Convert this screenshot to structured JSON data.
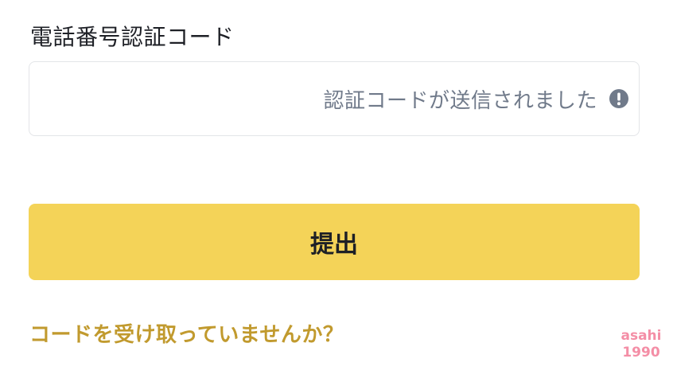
{
  "form": {
    "field_label": "電話番号認証コード",
    "input_value": "",
    "input_status": "認証コードが送信されました",
    "status_icon": "exclamation-circle-icon",
    "submit_label": "提出",
    "resend_link": "コードを受け取っていませんか？"
  },
  "watermark": {
    "line1": "asahi",
    "line2": "1990"
  },
  "colors": {
    "accent": "#f4d358",
    "link": "#c19a2e",
    "status_text": "#707a8a",
    "border": "#e3e5e8",
    "watermark": "#f48ea6"
  }
}
